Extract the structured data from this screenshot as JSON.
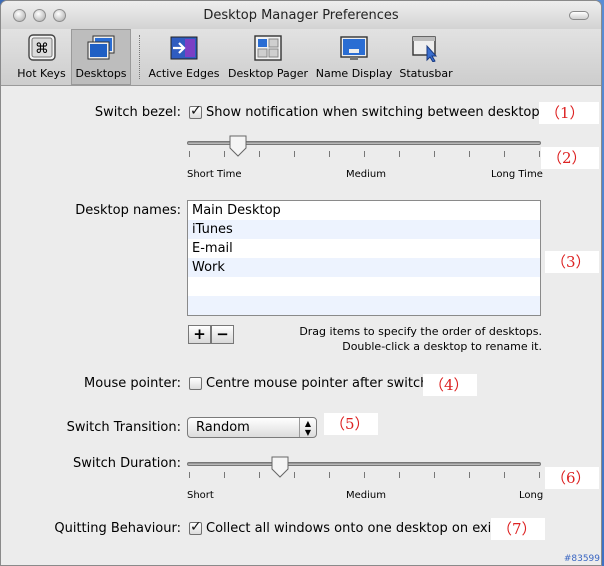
{
  "window": {
    "title": "Desktop Manager Preferences"
  },
  "toolbar": {
    "items": [
      {
        "label": "Hot Keys",
        "icon": "command-key-icon",
        "selected": false
      },
      {
        "label": "Desktops",
        "icon": "desktops-icon",
        "selected": true
      },
      {
        "label": "Active Edges",
        "icon": "active-edges-icon",
        "selected": false
      },
      {
        "label": "Desktop Pager",
        "icon": "desktop-pager-icon",
        "selected": false
      },
      {
        "label": "Name Display",
        "icon": "name-display-icon",
        "selected": false
      },
      {
        "label": "Statusbar",
        "icon": "statusbar-icon",
        "selected": false
      }
    ]
  },
  "switch_bezel": {
    "label": "Switch bezel:",
    "checkbox_label": "Show notification when switching between desktops",
    "checked": true,
    "slider": {
      "min_label": "Short Time",
      "mid_label": "Medium",
      "max_label": "Long Time",
      "value": 0.14
    }
  },
  "desktop_names": {
    "label": "Desktop names:",
    "items": [
      "Main Desktop",
      "iTunes",
      "E-mail",
      "Work"
    ],
    "add_label": "+",
    "remove_label": "−",
    "hint_line1": "Drag items to specify the order of desktops.",
    "hint_line2": "Double-click a desktop to rename it."
  },
  "mouse_pointer": {
    "label": "Mouse pointer:",
    "checkbox_label": "Centre mouse pointer after switch",
    "checked": false
  },
  "switch_transition": {
    "label": "Switch Transition:",
    "value": "Random"
  },
  "switch_duration": {
    "label": "Switch Duration:",
    "slider": {
      "min_label": "Short",
      "mid_label": "Medium",
      "max_label": "Long",
      "value": 0.26
    }
  },
  "quitting_behaviour": {
    "label": "Quitting Behaviour:",
    "checkbox_label": "Collect all windows onto one desktop on exit",
    "checked": true
  },
  "annotations": [
    "（1）",
    "（2）",
    "（3）",
    "（4）",
    "（5）",
    "（6）",
    "（7）"
  ],
  "colors": {
    "annotation": "#dd2222",
    "selected_row": "#edf3fe",
    "desktop_bg": "#4a7cc8"
  },
  "watermark": "#83599"
}
